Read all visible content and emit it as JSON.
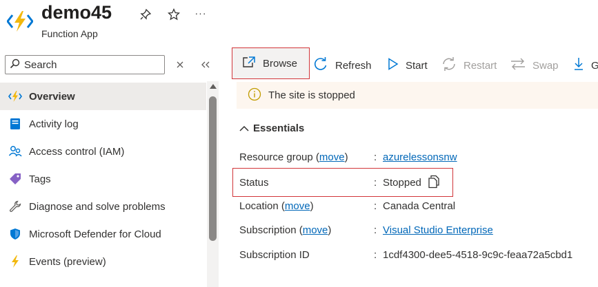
{
  "header": {
    "title": "demo45",
    "subtitle": "Function App",
    "pin_icon": "pin-icon",
    "favorite_icon": "star-icon",
    "more_label": "···"
  },
  "sidebar": {
    "search_placeholder": "Search",
    "items": [
      {
        "label": "Overview",
        "icon": "function-bolt-icon",
        "active": true
      },
      {
        "label": "Activity log",
        "icon": "activity-log-icon"
      },
      {
        "label": "Access control (IAM)",
        "icon": "people-icon"
      },
      {
        "label": "Tags",
        "icon": "tag-icon"
      },
      {
        "label": "Diagnose and solve problems",
        "icon": "wrench-icon"
      },
      {
        "label": "Microsoft Defender for Cloud",
        "icon": "shield-icon"
      },
      {
        "label": "Events (preview)",
        "icon": "lightning-icon"
      }
    ]
  },
  "toolbar": {
    "browse": "Browse",
    "refresh": "Refresh",
    "start": "Start",
    "restart": "Restart",
    "swap": "Swap",
    "get_publish_profile": "G"
  },
  "notice": {
    "text": "The site is stopped"
  },
  "essentials": {
    "heading": "Essentials",
    "move_link": "move",
    "rows": {
      "resource_group": {
        "label": "Resource group",
        "value": "azurelessonsnw"
      },
      "status": {
        "label": "Status",
        "value": "Stopped"
      },
      "location": {
        "label": "Location",
        "value": "Canada Central"
      },
      "subscription": {
        "label": "Subscription",
        "value": "Visual Studio Enterprise"
      },
      "subscription_id": {
        "label": "Subscription ID",
        "value": "1cdf4300-dee5-4518-9c9c-feaa72a5cbd1"
      }
    }
  },
  "colors": {
    "accent": "#0078d4",
    "highlight_border": "#d13438",
    "notice_bg": "#fdf6ef",
    "warning": "#c19c00",
    "link": "#0067b8"
  }
}
